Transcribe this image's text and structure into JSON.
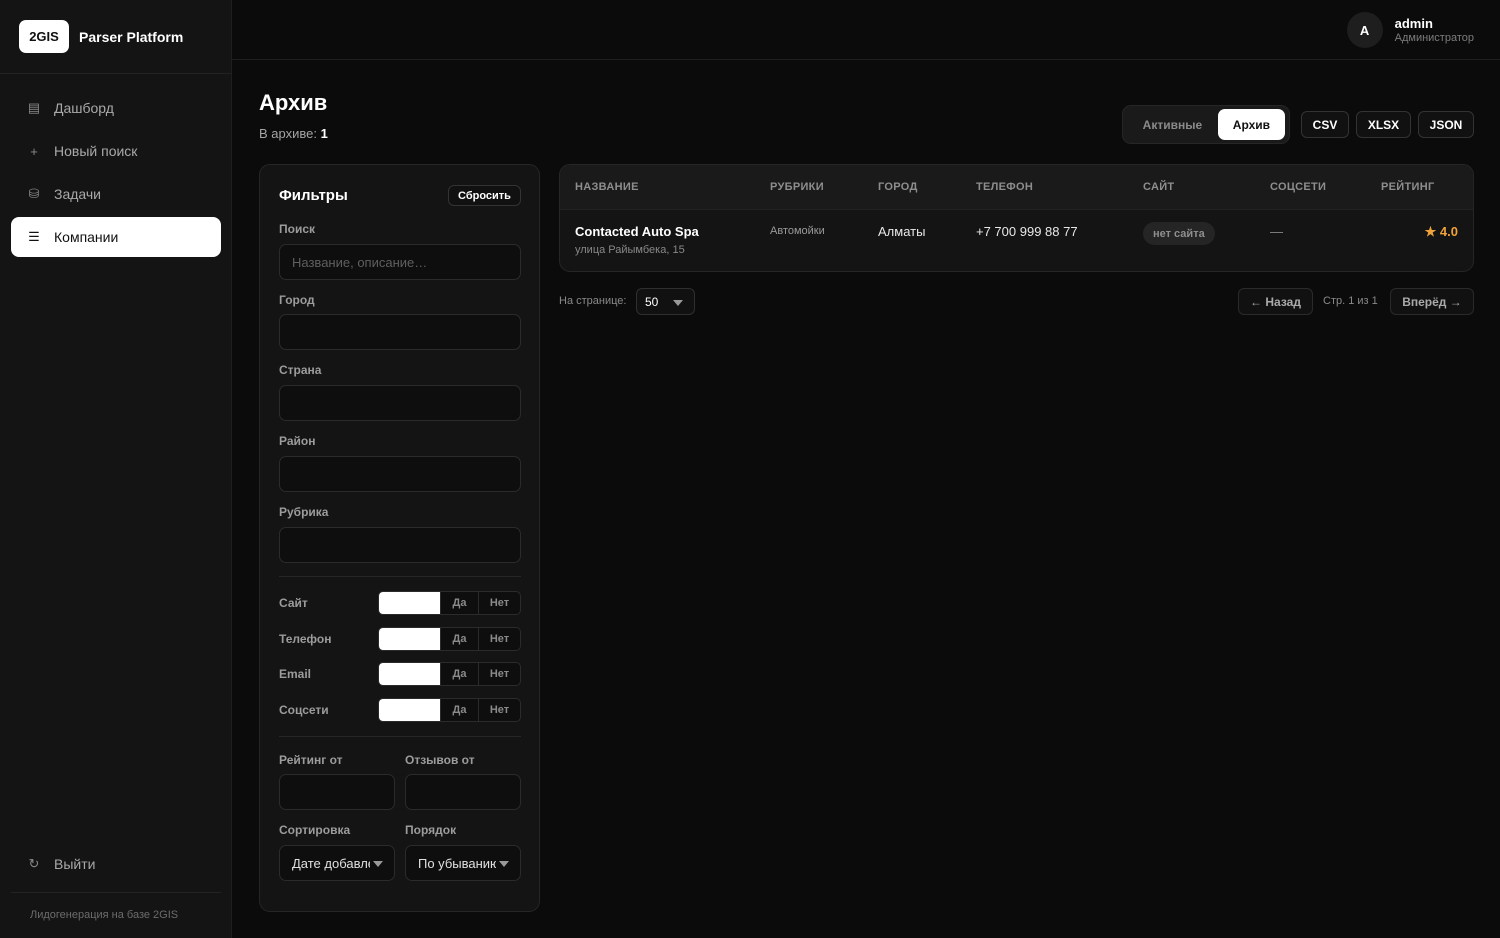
{
  "brand": {
    "logo": "2GIS",
    "name": "Parser Platform"
  },
  "nav": {
    "items": [
      {
        "label": "Дашборд",
        "icon": "▤"
      },
      {
        "label": "Новый поиск",
        "icon": "+"
      },
      {
        "label": "Задачи",
        "icon": "⛁"
      },
      {
        "label": "Компании",
        "icon": "☰"
      }
    ],
    "logout": {
      "label": "Выйти",
      "icon": "↻"
    },
    "footer": "Лидогенерация на базе 2GIS"
  },
  "user": {
    "initial": "A",
    "name": "admin",
    "role": "Администратор"
  },
  "header": {
    "title": "Архив",
    "subtitle_label": "В архиве:",
    "archive_count": "1",
    "segment": {
      "active_tab": "Активные",
      "archive_tab": "Архив"
    },
    "export": [
      "CSV",
      "XLSX",
      "JSON"
    ]
  },
  "filters": {
    "title": "Фильтры",
    "reset": "Сбросить",
    "search_label": "Поиск",
    "search_placeholder": "Название, описание…",
    "city_label": "Город",
    "country_label": "Страна",
    "district_label": "Район",
    "rubric_label": "Рубрика",
    "toggles": [
      {
        "label": "Сайт",
        "yes": "Да",
        "no": "Нет"
      },
      {
        "label": "Телефон",
        "yes": "Да",
        "no": "Нет"
      },
      {
        "label": "Email",
        "yes": "Да",
        "no": "Нет"
      },
      {
        "label": "Соцсети",
        "yes": "Да",
        "no": "Нет"
      }
    ],
    "rating_label": "Рейтинг от",
    "reviews_label": "Отзывов от",
    "sort_label": "Сортировка",
    "sort_value": "Дате добавления",
    "order_label": "Порядок",
    "order_value": "По убыванию"
  },
  "table": {
    "columns": [
      "НАЗВАНИЕ",
      "РУБРИКИ",
      "ГОРОД",
      "ТЕЛЕФОН",
      "САЙТ",
      "СОЦСЕТИ",
      "РЕЙТИНГ"
    ],
    "rows": [
      {
        "name": "Contacted Auto Spa",
        "address": "улица Райымбека, 15",
        "rubric": "Автомойки",
        "city": "Алматы",
        "phone": "+7 700 999 88 77",
        "site": "нет сайта",
        "social": "—",
        "rating": "★ 4.0"
      }
    ]
  },
  "pagination": {
    "per_page_label": "На странице:",
    "per_page_value": "50",
    "prev": "← Назад",
    "info": "Стр. 1 из 1",
    "next": "Вперёд →"
  },
  "colors": {
    "accent_rating": "#f0a33a",
    "background": "#0b0b0b",
    "panel": "#141414"
  }
}
